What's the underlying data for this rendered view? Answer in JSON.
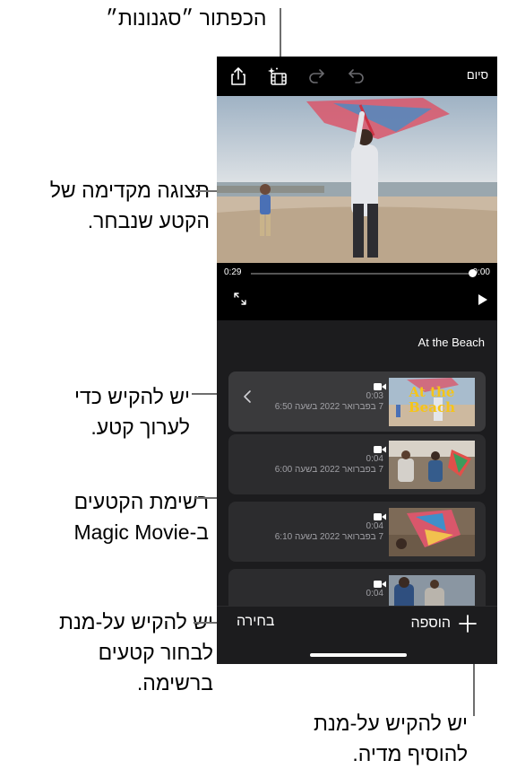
{
  "callouts": {
    "magic_button": "הכפתור ״סגנונות״",
    "preview_line1": "תצוגה מקדימה של",
    "preview_line2": "הקטע שנבחר.",
    "edit_line1": "יש להקיש כדי",
    "edit_line2": "לערוך קטע.",
    "list_line1": "רשימת הקטעים",
    "list_line2": "ב-Magic Movie",
    "select_line1": "יש להקיש על-מנת",
    "select_line2": "לבחור קטעים",
    "select_line3": "ברשימה.",
    "add_line1": "יש להקיש על-מנת",
    "add_line2": "להוסיף מדיה."
  },
  "toolbar": {
    "done_label": "סיום",
    "icons": [
      "share-icon",
      "styles-icon",
      "redo-icon",
      "undo-icon"
    ]
  },
  "player": {
    "elapsed": "0:00",
    "remaining": "0:29",
    "progress": 0.0
  },
  "project": {
    "title": "At the Beach"
  },
  "clips": [
    {
      "duration": "0:03",
      "date": "7 בפברואר 2022 בשעה 6:50",
      "selected": true,
      "thumb_caption": "At the Beach"
    },
    {
      "duration": "0:04",
      "date": "7 בפברואר 2022 בשעה 6:00",
      "selected": false
    },
    {
      "duration": "0:04",
      "date": "7 בפברואר 2022 בשעה 6:10",
      "selected": false
    },
    {
      "duration": "0:04",
      "date": "",
      "selected": false
    }
  ],
  "bottom": {
    "select_label": "בחירה",
    "add_label": "הוספה"
  },
  "colors": {
    "phone_bg": "#1c1c1e",
    "clip_bg": "#2c2c2e",
    "accent_title_text": "#f5c518"
  }
}
